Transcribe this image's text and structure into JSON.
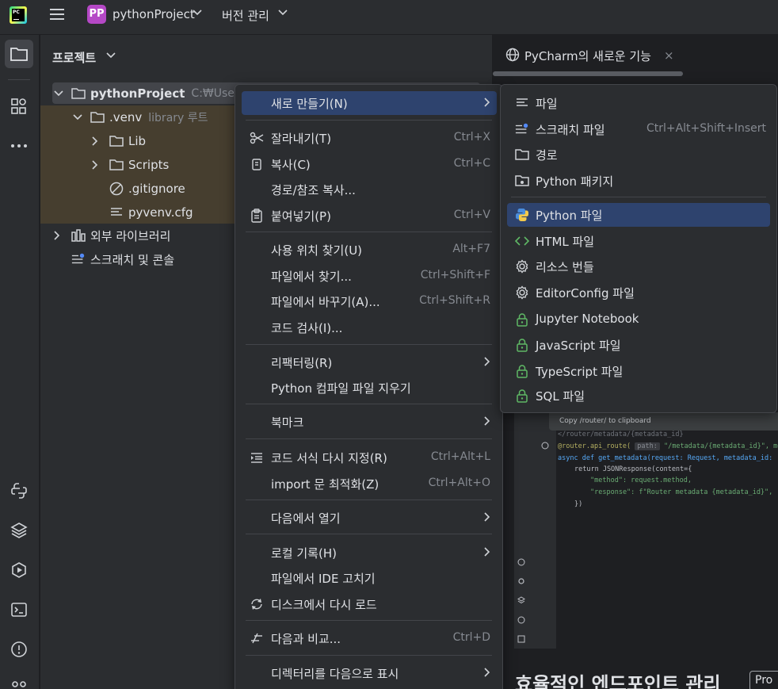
{
  "titlebar": {
    "avatar": "PP",
    "project_name": "pythonProject",
    "vcs_label": "버전 관리"
  },
  "panel": {
    "title": "프로젝트"
  },
  "tree": {
    "root_name": "pythonProject",
    "root_path": "C:₩Users₩",
    "venv_name": ".venv",
    "venv_note": "library 루트",
    "lib": "Lib",
    "scripts": "Scripts",
    "gitignore": ".gitignore",
    "pyvenv": "pyvenv.cfg",
    "external_libs": "외부 라이브러리",
    "scratches": "스크래치 및 콘솔"
  },
  "editor": {
    "tab_label": "PyCharm의 새로운 기능",
    "tab_close": "×",
    "heading": "효율적인 엔드포인트 관리",
    "chip": "Pro",
    "tooltip": "Copy /router/ to clipboard",
    "code": {
      "line1": "</router/metadata/{metadata_id}",
      "line2_a": "@router.api_route(",
      "line2_path": "path:",
      "line2_b": "\"/metadata/{metadata_id}\", meth",
      "line3": "async def get_metadata(request: Request, metadata_id:",
      "line4": "return JSONResponse(content={",
      "line5": "\"method\": request.method,",
      "line6": "\"response\": f\"Router metadata {metadata_id}\",",
      "line7": "})"
    }
  },
  "context_menu": {
    "new": "새로 만들기(N)",
    "cut": "잘라내기(T)",
    "cut_sc": "Ctrl+X",
    "copy": "복사(C)",
    "copy_sc": "Ctrl+C",
    "copy_path": "경로/참조 복사...",
    "paste": "붙여넣기(P)",
    "paste_sc": "Ctrl+V",
    "find_usages": "사용 위치 찾기(U)",
    "find_usages_sc": "Alt+F7",
    "find_in_files": "파일에서 찾기...",
    "find_in_files_sc": "Ctrl+Shift+F",
    "replace_in_files": "파일에서 바꾸기(A)...",
    "replace_in_files_sc": "Ctrl+Shift+R",
    "inspect_code": "코드 검사(I)...",
    "refactor": "리팩터링(R)",
    "delete_compiled": "Python 컴파일 파일 지우기",
    "bookmarks": "북마크",
    "reformat": "코드 서식 다시 지정(R)",
    "reformat_sc": "Ctrl+Alt+L",
    "optimize_imports": "import 문 최적화(Z)",
    "optimize_imports_sc": "Ctrl+Alt+O",
    "open_in": "다음에서 열기",
    "local_history": "로컬 기록(H)",
    "fix_ide": "파일에서 IDE 고치기",
    "reload": "디스크에서 다시 로드",
    "compare": "다음과 비교...",
    "compare_sc": "Ctrl+D",
    "mark_dir": "디렉터리를 다음으로 표시"
  },
  "submenu": {
    "file": "파일",
    "scratch": "스크래치 파일",
    "scratch_sc": "Ctrl+Alt+Shift+Insert",
    "directory": "경로",
    "python_package": "Python 패키지",
    "python_file": "Python 파일",
    "html_file": "HTML 파일",
    "resource_bundle": "리소스 번들",
    "editorconfig": "EditorConfig 파일",
    "jupyter": "Jupyter Notebook",
    "javascript": "JavaScript 파일",
    "typescript": "TypeScript 파일",
    "sql": "SQL 파일"
  },
  "colors": {
    "accent_selection": "#2e436e",
    "venv_highlight": "#463e2f",
    "avatar_bg": "#b548c6",
    "lock_icon": "#5fb865",
    "html_icon": "#5fb865"
  }
}
